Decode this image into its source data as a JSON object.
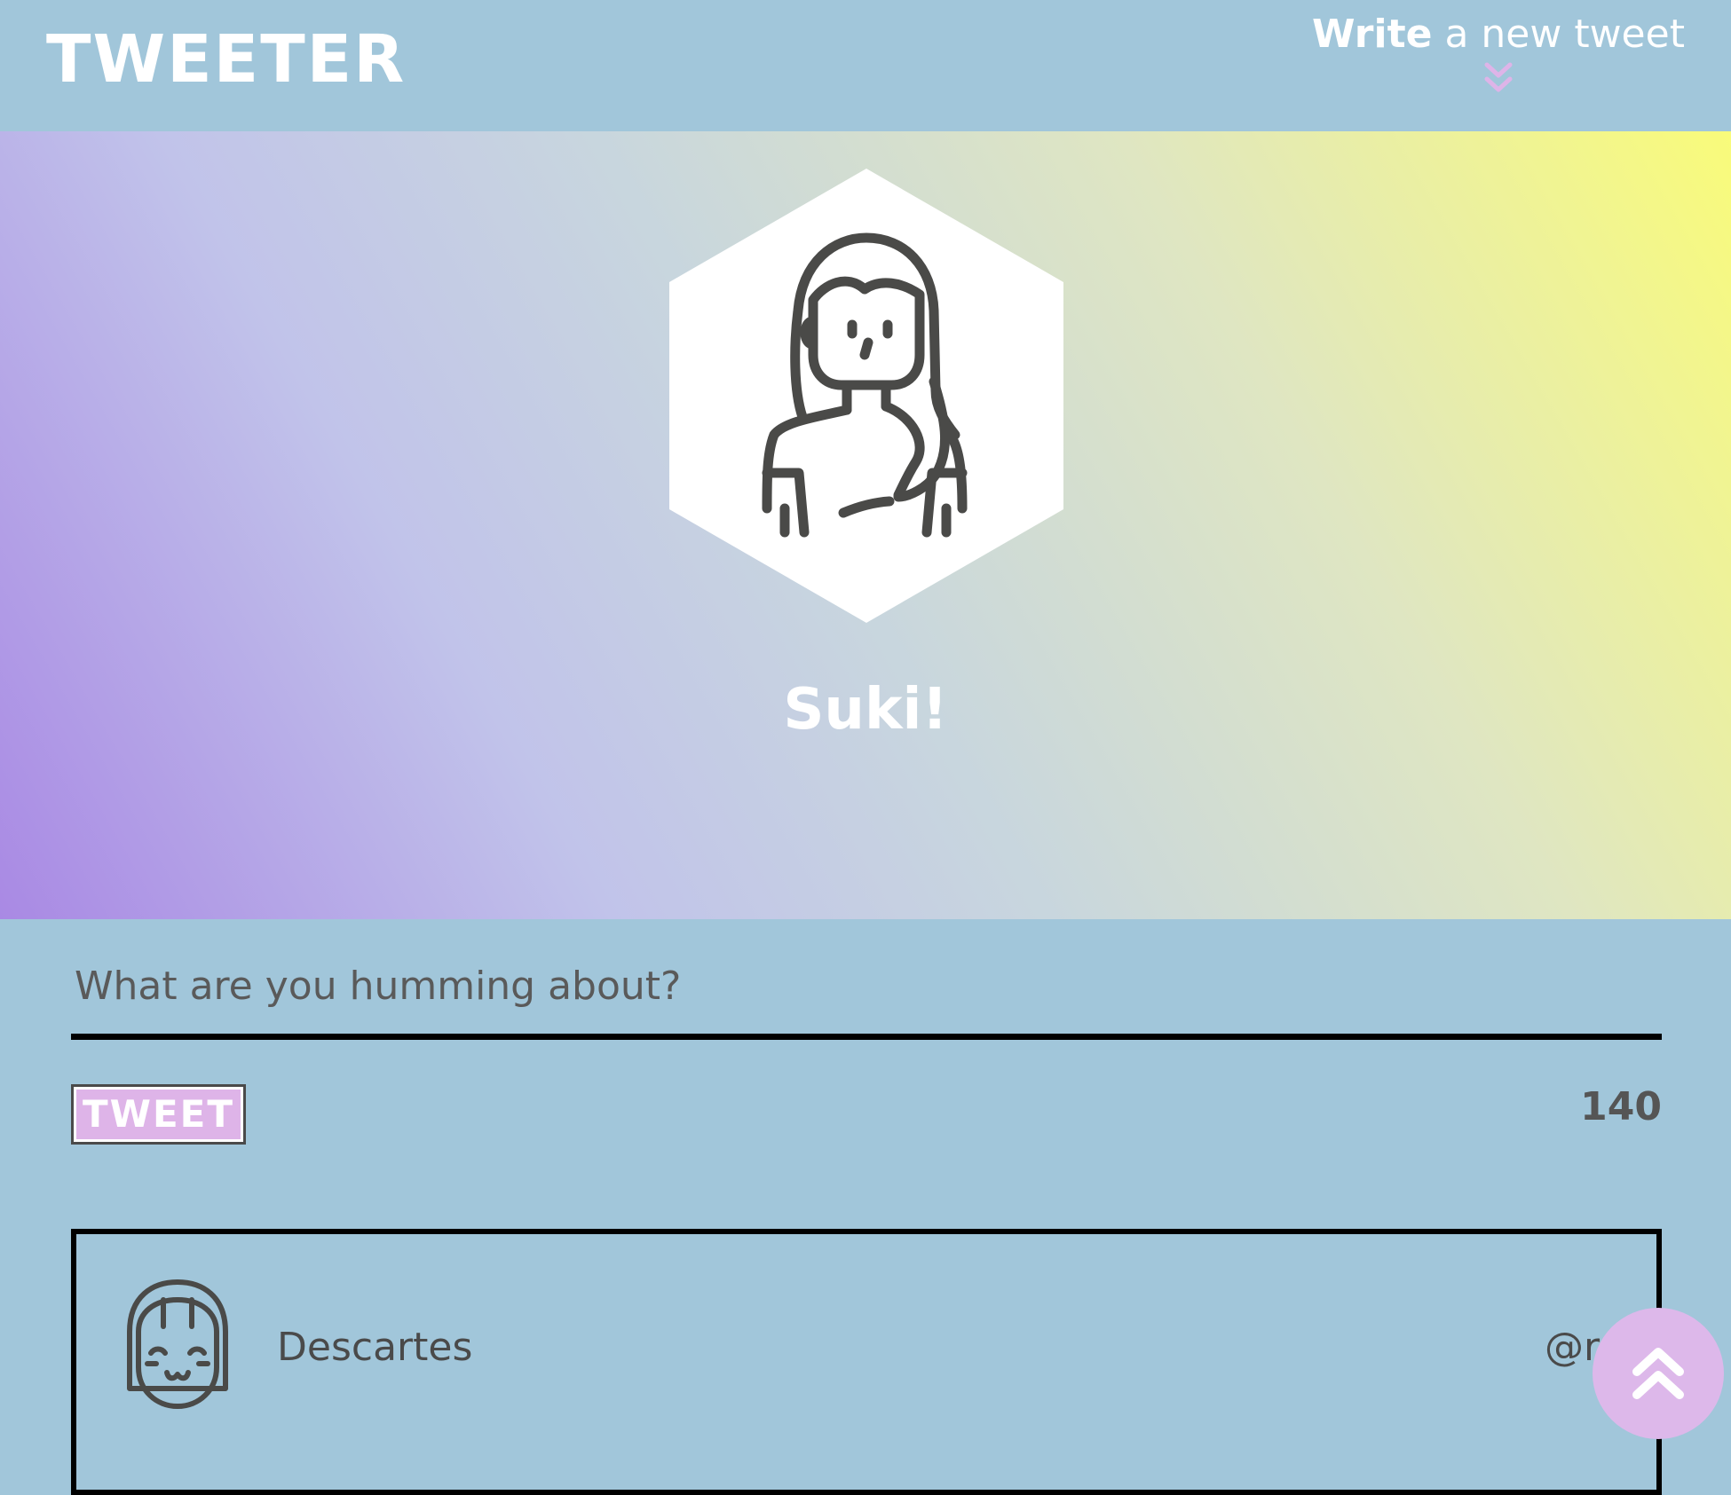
{
  "header": {
    "brand": "TWEETER",
    "write_bold": "Write",
    "write_rest": " a new tweet",
    "toggle_icon": "chevron-double-down-icon"
  },
  "profile": {
    "avatar_icon": "girl-avatar-icon",
    "name": "Suki!"
  },
  "compose": {
    "placeholder": "What are you humming about?",
    "value": "",
    "tweet_button_label": "TWEET",
    "char_count": "140"
  },
  "tweets": [
    {
      "avatar_icon": "smiling-girl-avatar-icon",
      "name": "Descartes",
      "handle": "@rd"
    }
  ],
  "scroll_top": {
    "icon": "chevron-double-up-icon"
  },
  "colors": {
    "background": "#a1c6da",
    "accent": "#ddb8ea",
    "text_dark": "#4a4a4a",
    "gradient_start": "#a989e4",
    "gradient_end": "#f9fb7a"
  }
}
